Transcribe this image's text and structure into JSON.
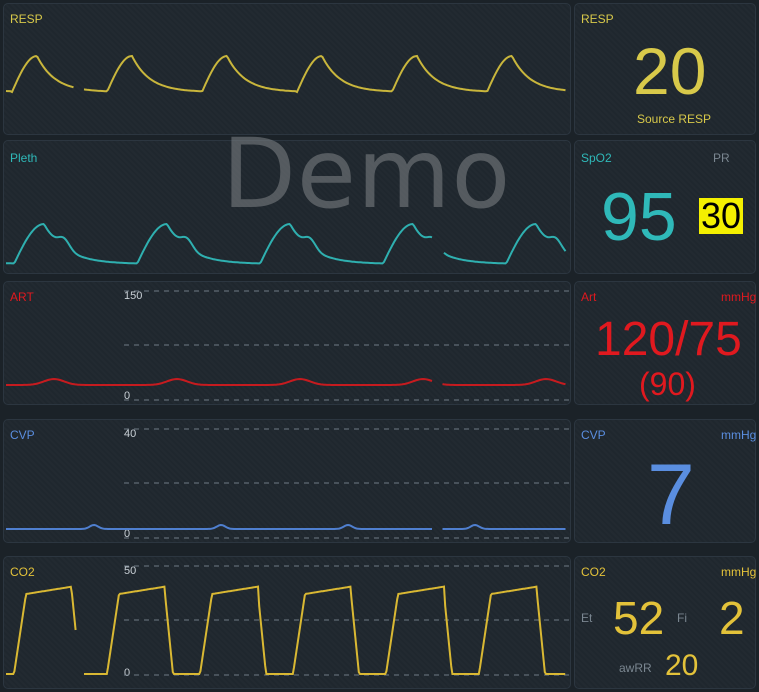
{
  "watermark": "Demo",
  "colors": {
    "resp": "#d8c94a",
    "spo2": "#2fb9b9",
    "art": "#e0191f",
    "cvp": "#5a8ee0",
    "co2": "#e3c23a",
    "pr_bg": "#f4f000",
    "muted": "#7a8690"
  },
  "resp": {
    "wave_label": "RESP",
    "panel_label": "RESP",
    "value": "20",
    "source": "Source RESP"
  },
  "pleth": {
    "wave_label": "Pleth",
    "panel_label": "SpO2",
    "pr_label": "PR",
    "spo2_value": "95",
    "pr_value": "30"
  },
  "art": {
    "wave_label": "ART",
    "scale_top": "150",
    "scale_bottom": "0",
    "panel_label": "Art",
    "unit": "mmHg",
    "value": "120/75",
    "mean": "(90)"
  },
  "cvp": {
    "wave_label": "CVP",
    "scale_top": "40",
    "scale_bottom": "0",
    "panel_label": "CVP",
    "unit": "mmHg",
    "value": "7"
  },
  "co2": {
    "wave_label": "CO2",
    "scale_top": "50",
    "scale_bottom": "0",
    "panel_label": "CO2",
    "unit": "mmHg",
    "et_label": "Et",
    "et_value": "52",
    "fi_label": "Fi",
    "fi_value": "2",
    "awrr_label": "awRR",
    "awrr_value": "20"
  }
}
